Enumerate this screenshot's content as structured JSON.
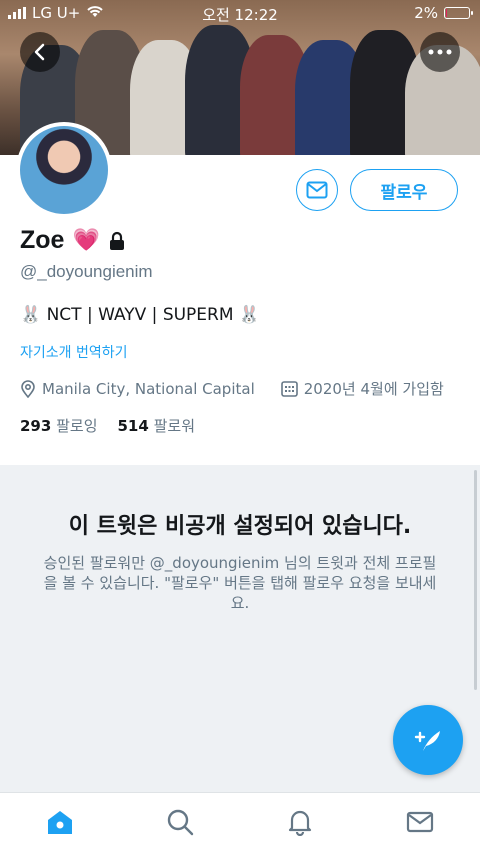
{
  "status_bar": {
    "carrier": "LG U+",
    "time": "오전 12:22",
    "battery": "2%",
    "battery_level": 0.02
  },
  "colors": {
    "accent": "#1da1f2",
    "muted": "#657786",
    "private_bg": "#eef1f4",
    "battery_low": "#e0245e"
  },
  "profile": {
    "name": "Zoe",
    "name_emoji": "💗",
    "locked_icon": "lock-icon",
    "handle": "@_doyoungienim",
    "bio": "🐰 NCT | WAYV | SUPERM 🐰",
    "translate_bio": "자기소개 번역하기",
    "location": "Manila City, National Capital",
    "joined": "2020년 4월에 가입함",
    "following_count": "293",
    "following_label": "팔로잉",
    "followers_count": "514",
    "followers_label": "팔로워"
  },
  "actions": {
    "follow_label": "팔로우",
    "message_icon": "envelope-icon",
    "back_icon": "chevron-left-icon",
    "more_icon": "more-dots-icon"
  },
  "private_notice": {
    "title": "이 트윗은 비공개 설정되어 있습니다.",
    "body": "승인된 팔로워만 @_doyoungienim 님의 트윗과 전체 프로필을 볼 수 있습니다. \"팔로우\" 버튼을 탭해 팔로우 요청을 보내세요."
  },
  "tabbar": [
    "home-icon",
    "search-icon",
    "bell-icon",
    "mail-icon"
  ]
}
